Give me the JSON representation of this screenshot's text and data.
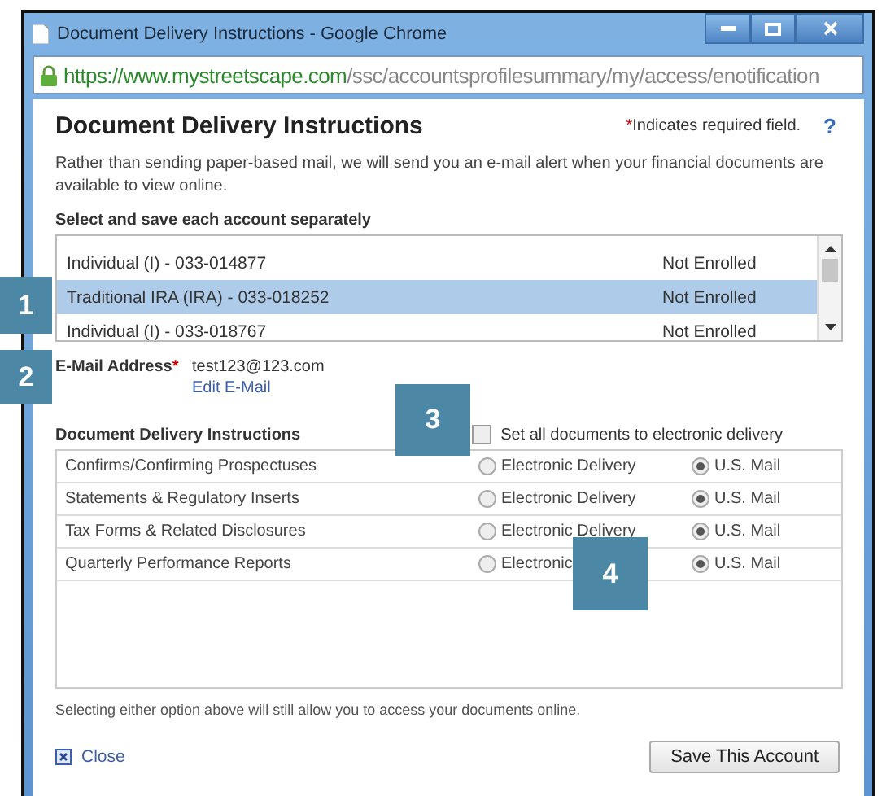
{
  "window": {
    "title": "Document Delivery Instructions - Google Chrome"
  },
  "address_bar": {
    "url_host": "https://www.mystreetscape.com",
    "url_path": "/ssc/accountsprofilesummary/my/access/enotification"
  },
  "page": {
    "heading": "Document Delivery Instructions",
    "required_mark": "*",
    "required_note": "Indicates required field.",
    "help": "?",
    "intro": "Rather than sending paper-based mail, we will send you an e-mail alert when your financial documents are available to view online."
  },
  "accounts": {
    "label": "Select and save each account separately",
    "rows": [
      {
        "name": "Individual (I) - 033-014877",
        "status": "Not Enrolled",
        "selected": false
      },
      {
        "name": "Traditional IRA (IRA) - 033-018252",
        "status": "Not Enrolled",
        "selected": true
      },
      {
        "name": "Individual (I) - 033-018767",
        "status": "Not Enrolled",
        "selected": false
      }
    ]
  },
  "email": {
    "label": "E-Mail Address",
    "required_mark": "*",
    "value": "test123@123.com",
    "edit_link": "Edit E-Mail"
  },
  "delivery": {
    "label": "Document Delivery Instructions",
    "set_all": {
      "label": "Set all documents to electronic delivery",
      "checked": false
    },
    "rows": [
      {
        "name": "Confirms/Confirming Prospectuses",
        "electronic_label": "Electronic Delivery",
        "mail_label": "U.S. Mail",
        "electronic_selected": false,
        "mail_selected": true
      },
      {
        "name": "Statements & Regulatory Inserts",
        "electronic_label": "Electronic Delivery",
        "mail_label": "U.S. Mail",
        "electronic_selected": false,
        "mail_selected": true
      },
      {
        "name": "Tax Forms & Related Disclosures",
        "electronic_label": "Electronic Delivery",
        "mail_label": "U.S. Mail",
        "electronic_selected": false,
        "mail_selected": true
      },
      {
        "name": "Quarterly Performance Reports",
        "electronic_label": "Electronic",
        "mail_label": "U.S. Mail",
        "electronic_selected": false,
        "mail_selected": true
      }
    ],
    "note": "Selecting either option above will still allow you to access your documents online."
  },
  "footer": {
    "close": "Close",
    "save": "Save This Account"
  },
  "callouts": [
    {
      "label": "1"
    },
    {
      "label": "2"
    },
    {
      "label": "3"
    },
    {
      "label": "4"
    }
  ]
}
